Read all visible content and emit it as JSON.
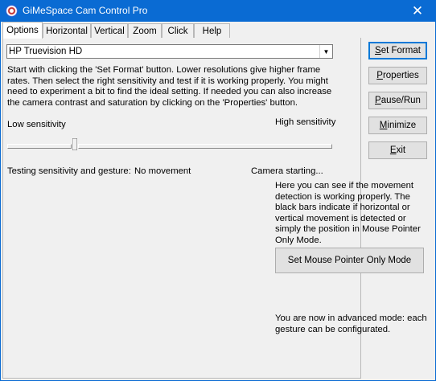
{
  "window": {
    "title": "GiMeSpace Cam Control Pro",
    "close_glyph": "✕"
  },
  "tabs": [
    {
      "label": "Options",
      "active": true
    },
    {
      "label": "Horizontal",
      "active": false
    },
    {
      "label": "Vertical",
      "active": false
    },
    {
      "label": "Zoom",
      "active": false
    },
    {
      "label": "Click",
      "active": false
    },
    {
      "label": "Help",
      "active": false
    }
  ],
  "camera_select": {
    "value": "HP Truevision HD",
    "arrow_glyph": "▼"
  },
  "intro_text": "Start with clicking the 'Set Format' button. Lower resolutions give higher frame rates. Then select the right sensitivity and test if it is working properly. You might need to experiment a bit to find the ideal setting. If needed you can also increase the camera contrast and saturation by clicking on the 'Properties' button.",
  "sensitivity": {
    "low_label": "Low sensitivity",
    "high_label": "High sensitivity",
    "value_fraction": 0.2
  },
  "status": {
    "testing_label": "Testing sensitivity and gesture:",
    "movement_value": "No movement",
    "camera_status": "Camera starting..."
  },
  "buttons": {
    "set_format": {
      "pre": "",
      "accel": "S",
      "post": "et Format"
    },
    "properties": {
      "pre": "",
      "accel": "P",
      "post": "roperties"
    },
    "pause_run": {
      "pre": "",
      "accel": "P",
      "post": "ause/Run"
    },
    "minimize": {
      "pre": "",
      "accel": "M",
      "post": "inimize"
    },
    "exit": {
      "pre": "",
      "accel": "E",
      "post": "xit"
    }
  },
  "info_text": "Here you can see if the movement detection is working properly. The black bars indicate if horizontal or vertical movement is detected or simply the position in Mouse Pointer Only Mode.",
  "mouse_mode_button": "Set Mouse Pointer Only Mode",
  "advanced_text": "You are now in advanced mode: each gesture can be configurated."
}
